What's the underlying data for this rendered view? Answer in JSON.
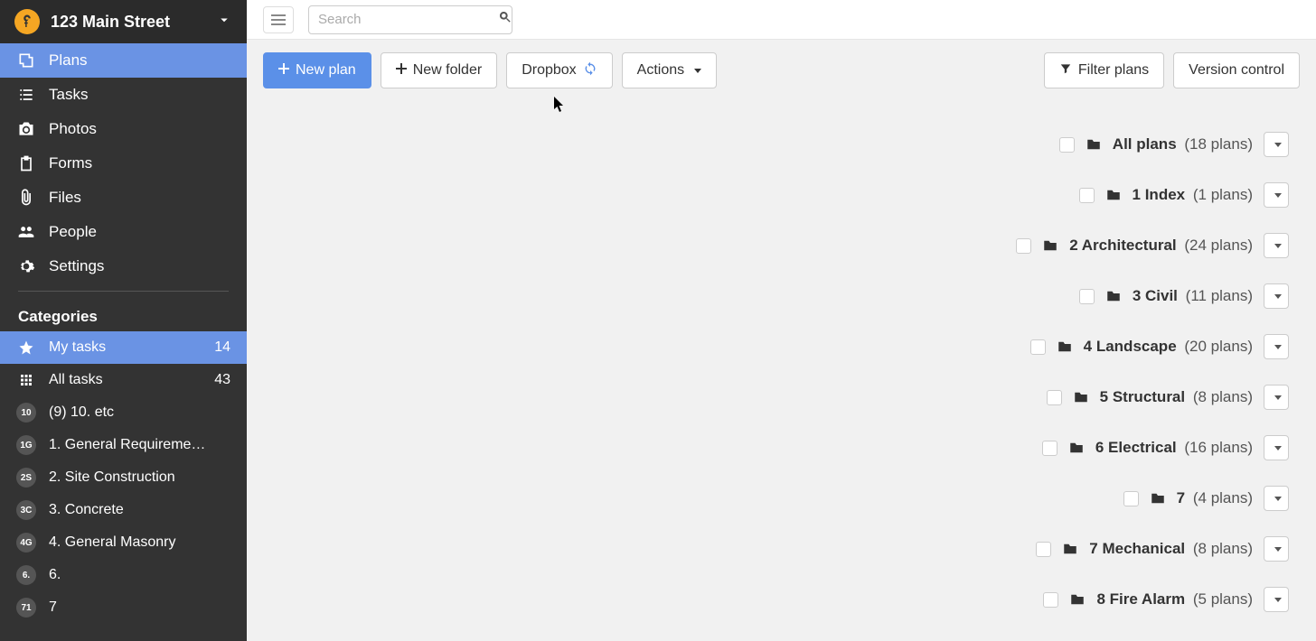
{
  "sidebar": {
    "project_title": "123 Main Street",
    "nav": [
      {
        "key": "plans",
        "label": "Plans",
        "active": true,
        "icon": "blueprint"
      },
      {
        "key": "tasks",
        "label": "Tasks",
        "active": false,
        "icon": "list"
      },
      {
        "key": "photos",
        "label": "Photos",
        "active": false,
        "icon": "camera"
      },
      {
        "key": "forms",
        "label": "Forms",
        "active": false,
        "icon": "clipboard"
      },
      {
        "key": "files",
        "label": "Files",
        "active": false,
        "icon": "paperclip"
      },
      {
        "key": "people",
        "label": "People",
        "active": false,
        "icon": "people"
      },
      {
        "key": "settings",
        "label": "Settings",
        "active": false,
        "icon": "gear"
      }
    ],
    "categories_title": "Categories",
    "categories": [
      {
        "badge_type": "icon",
        "badge": "star",
        "label": "My tasks",
        "count": "14",
        "active": true
      },
      {
        "badge_type": "icon",
        "badge": "grid",
        "label": "All tasks",
        "count": "43",
        "active": false
      },
      {
        "badge_type": "text",
        "badge": "10",
        "label": "(9) 10. etc",
        "count": "",
        "active": false
      },
      {
        "badge_type": "text",
        "badge": "1G",
        "label": "1. General Requireme…",
        "count": "",
        "active": false
      },
      {
        "badge_type": "text",
        "badge": "2S",
        "label": "2. Site Construction",
        "count": "",
        "active": false
      },
      {
        "badge_type": "text",
        "badge": "3C",
        "label": "3. Concrete",
        "count": "",
        "active": false
      },
      {
        "badge_type": "text",
        "badge": "4G",
        "label": "4. General Masonry",
        "count": "",
        "active": false
      },
      {
        "badge_type": "text",
        "badge": "6.",
        "label": "6.",
        "count": "",
        "active": false
      },
      {
        "badge_type": "text",
        "badge": "71",
        "label": "7",
        "count": "",
        "active": false
      }
    ]
  },
  "topbar": {
    "search_placeholder": "Search"
  },
  "toolbar": {
    "new_plan": "New plan",
    "new_folder": "New folder",
    "dropbox": "Dropbox",
    "actions": "Actions",
    "filter_plans": "Filter plans",
    "version_control": "Version control"
  },
  "folders": [
    {
      "name": "All plans",
      "count_text": "(18 plans)"
    },
    {
      "name": "1 Index",
      "count_text": "(1 plans)"
    },
    {
      "name": "2 Architectural",
      "count_text": "(24 plans)"
    },
    {
      "name": "3 Civil",
      "count_text": "(11 plans)"
    },
    {
      "name": "4 Landscape",
      "count_text": "(20 plans)"
    },
    {
      "name": "5 Structural",
      "count_text": "(8 plans)"
    },
    {
      "name": "6 Electrical",
      "count_text": "(16 plans)"
    },
    {
      "name": "7",
      "count_text": "(4 plans)"
    },
    {
      "name": "7 Mechanical",
      "count_text": "(8 plans)"
    },
    {
      "name": "8 Fire Alarm",
      "count_text": "(5 plans)"
    }
  ]
}
